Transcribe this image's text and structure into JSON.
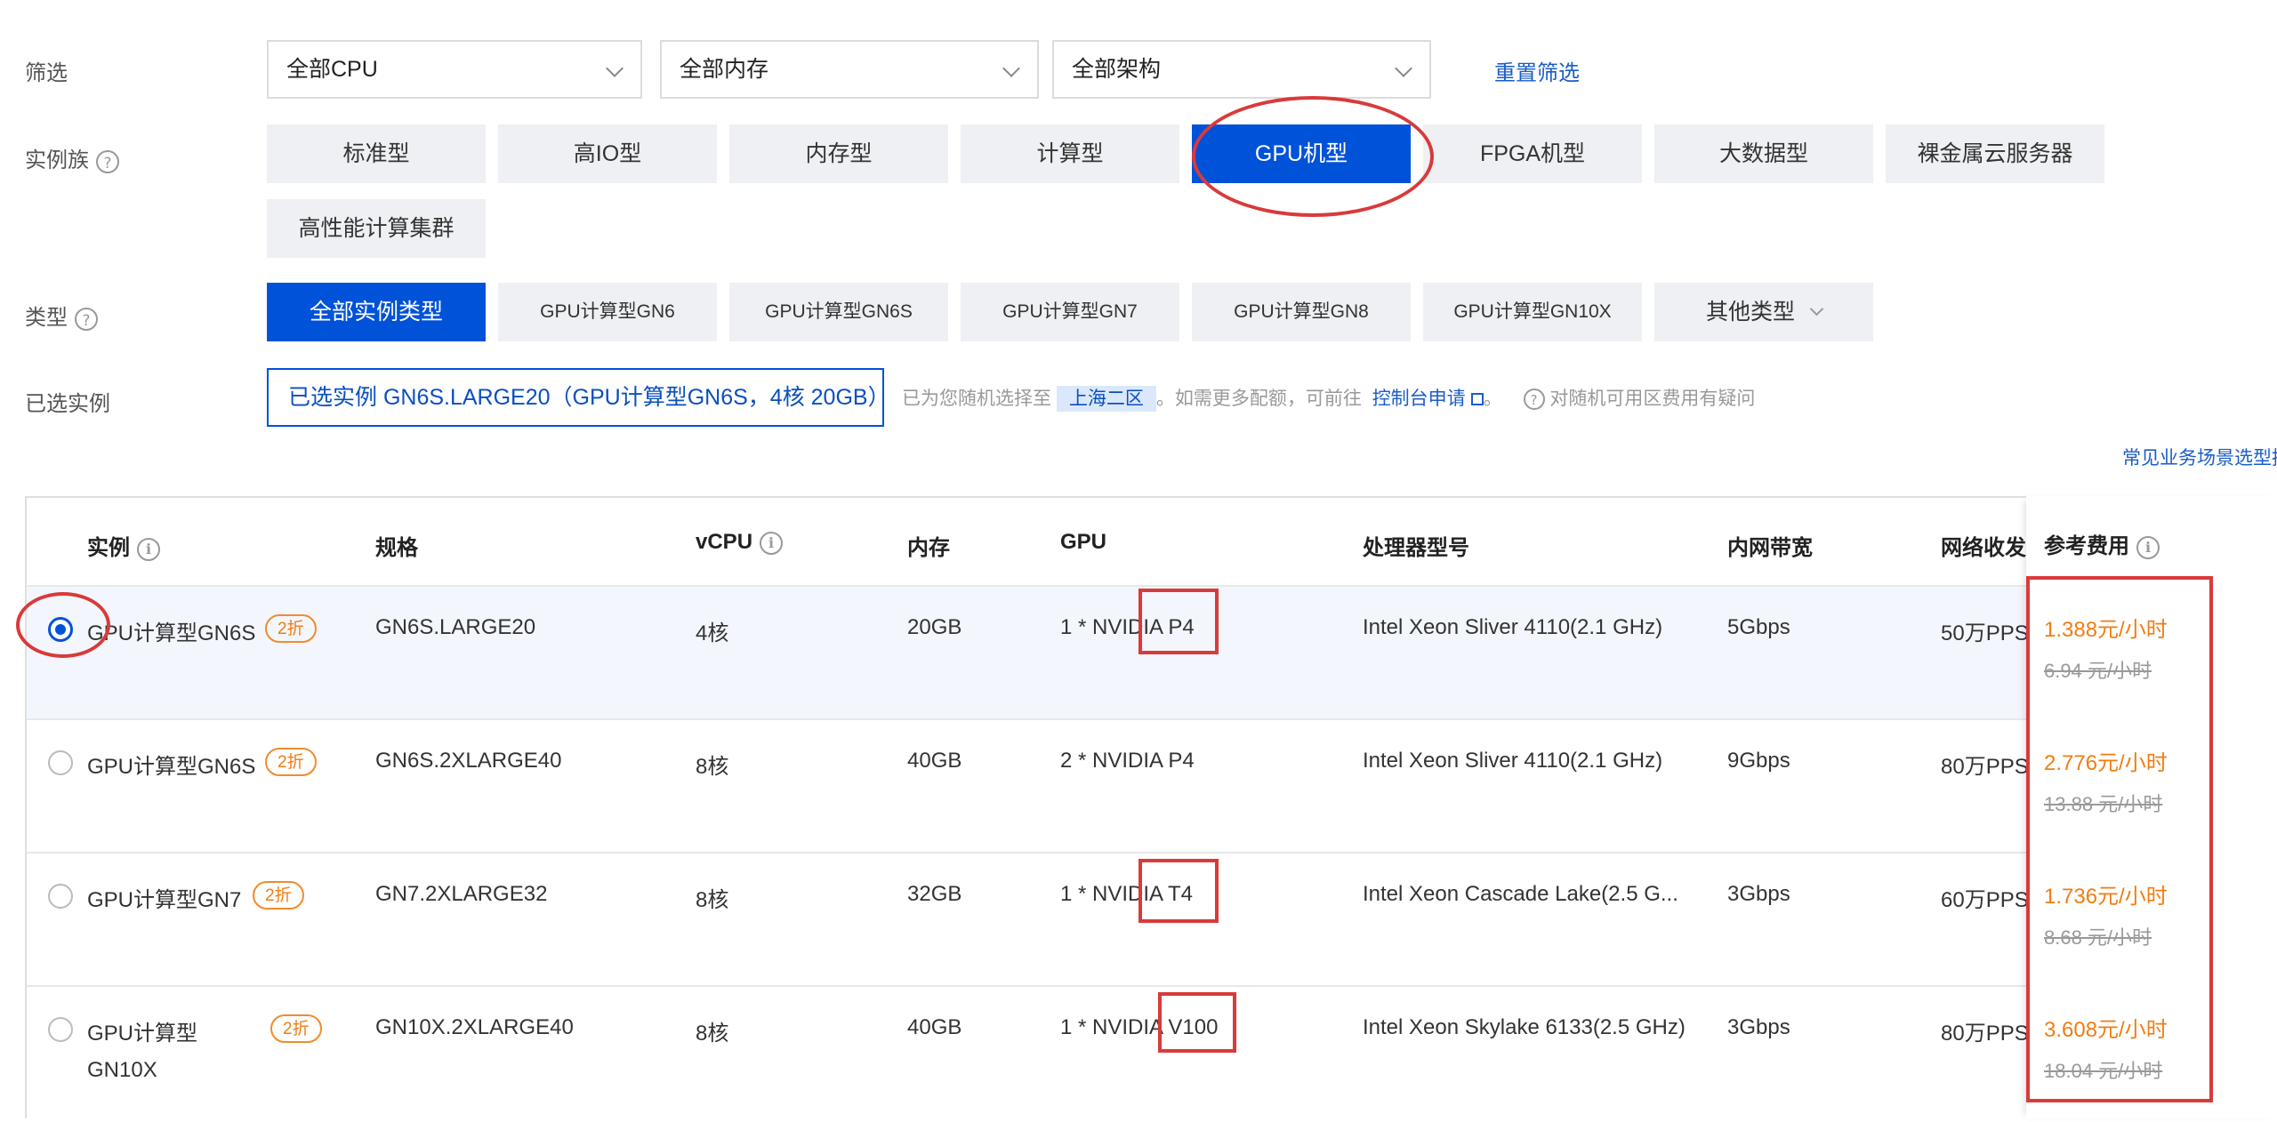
{
  "filters": {
    "label": "筛选",
    "cpu": "全部CPU",
    "memory": "全部内存",
    "arch": "全部架构",
    "reset": "重置筛选"
  },
  "family": {
    "label": "实例族",
    "items": [
      "标准型",
      "高IO型",
      "内存型",
      "计算型",
      "GPU机型",
      "FPGA机型",
      "大数据型",
      "裸金属云服务器",
      "高性能计算集群"
    ],
    "active_index": 4
  },
  "type": {
    "label": "类型",
    "items": [
      "全部实例类型",
      "GPU计算型GN6",
      "GPU计算型GN6S",
      "GPU计算型GN7",
      "GPU计算型GN8",
      "GPU计算型GN10X",
      "其他类型"
    ],
    "active_index": 0
  },
  "selected": {
    "label": "已选实例",
    "value": "已选实例 GN6S.LARGE20（GPU计算型GN6S，4核 20GB）",
    "hint_prefix": "已为您随机选择至",
    "region": "上海二区",
    "hint_mid": "。如需更多配额，可前往",
    "console_link": "控制台申请",
    "hint_end": "。",
    "question": "对随机可用区费用有疑问"
  },
  "scenario_link": "常见业务场景选型推荐",
  "table": {
    "headers": {
      "instance": "实例",
      "spec": "规格",
      "vcpu": "vCPU",
      "memory": "内存",
      "gpu": "GPU",
      "cpu_model": "处理器型号",
      "bandwidth": "内网带宽",
      "pps": "网络收发包",
      "price": "参考费用"
    },
    "rows": [
      {
        "name": "GPU计算型GN6S",
        "name2": "",
        "discount": "2折",
        "spec": "GN6S.LARGE20",
        "vcpu": "4核",
        "memory": "20GB",
        "gpu": "1 * NVIDIA P4",
        "cpu_model": "Intel Xeon Sliver 4110(2.1 GHz)",
        "bandwidth": "5Gbps",
        "pps": "50万PPS",
        "price": "1.388元/小时",
        "orig_price": "6.94 元/小时",
        "selected": true
      },
      {
        "name": "GPU计算型GN6S",
        "name2": "",
        "discount": "2折",
        "spec": "GN6S.2XLARGE40",
        "vcpu": "8核",
        "memory": "40GB",
        "gpu": "2 * NVIDIA P4",
        "cpu_model": "Intel Xeon Sliver 4110(2.1 GHz)",
        "bandwidth": "9Gbps",
        "pps": "80万PPS",
        "price": "2.776元/小时",
        "orig_price": "13.88 元/小时",
        "selected": false
      },
      {
        "name": "GPU计算型GN7",
        "name2": "",
        "discount": "2折",
        "spec": "GN7.2XLARGE32",
        "vcpu": "8核",
        "memory": "32GB",
        "gpu": "1 * NVIDIA T4",
        "cpu_model": "Intel Xeon Cascade Lake(2.5 G...",
        "bandwidth": "3Gbps",
        "pps": "60万PPS",
        "price": "1.736元/小时",
        "orig_price": "8.68 元/小时",
        "selected": false
      },
      {
        "name": "GPU计算型",
        "name2": "GN10X",
        "discount": "2折",
        "spec": "GN10X.2XLARGE40",
        "vcpu": "8核",
        "memory": "40GB",
        "gpu": "1 * NVIDIA V100",
        "cpu_model": "Intel Xeon Skylake 6133(2.5 GHz)",
        "bandwidth": "3Gbps",
        "pps": "80万PPS",
        "price": "3.608元/小时",
        "orig_price": "18.04 元/小时",
        "selected": false
      }
    ]
  }
}
